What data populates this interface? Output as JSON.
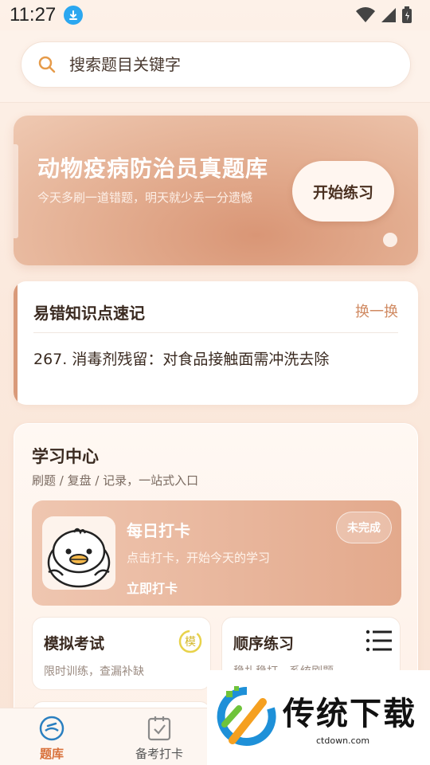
{
  "status": {
    "time": "11:27"
  },
  "search": {
    "placeholder": "搜索题目关键字"
  },
  "banner": {
    "title": "动物疫病防治员真题库",
    "subtitle": "今天多刷一道错题，明天就少丢一分遗憾",
    "button": "开始练习"
  },
  "knowledge": {
    "title": "易错知识点速记",
    "switch_label": "换一换",
    "item": "267. 消毒剂残留：对食品接触面需冲洗去除"
  },
  "study": {
    "title": "学习中心",
    "subtitle": "刷题 / 复盘 / 记录，一站式入口",
    "checkin": {
      "title": "每日打卡",
      "subtitle": "点击打卡，开始今天的学习",
      "link": "立即打卡",
      "badge": "未完成"
    },
    "cards": [
      {
        "title": "模拟考试",
        "subtitle": "限时训练，查漏补缺",
        "icon_char": "模"
      },
      {
        "title": "顺序练习",
        "subtitle": "稳扎稳打，系统刷题"
      }
    ]
  },
  "tabs": [
    {
      "label": "题库",
      "active": true
    },
    {
      "label": "备考打卡",
      "active": false
    }
  ],
  "watermark": {
    "text": "传统下载",
    "url": "ctdown.com"
  },
  "colors": {
    "accent": "#d08a62",
    "active_tab": "#d8703a",
    "tab_icon": "#2a7fc0"
  }
}
